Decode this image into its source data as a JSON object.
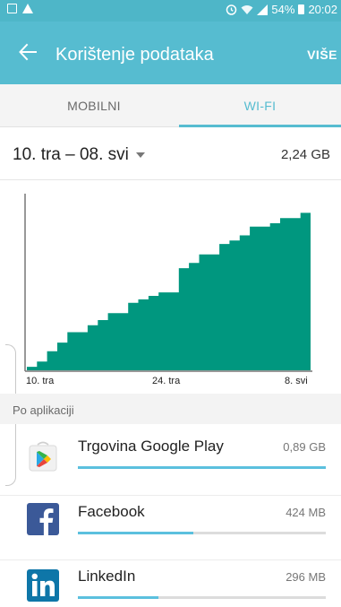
{
  "status_bar": {
    "battery": "54%",
    "time": "20:02"
  },
  "app_bar": {
    "title": "Korištenje podataka",
    "more_label": "VIŠE",
    "back_icon": "arrow-left-icon"
  },
  "tabs": [
    {
      "label": "MOBILNI",
      "selected": false
    },
    {
      "label": "WI-FI",
      "selected": true
    }
  ],
  "period": {
    "range": "10. tra – 08. svi",
    "total": "2,24 GB"
  },
  "colors": {
    "accent": "#56bcd0",
    "chart_fill": "#00977f",
    "usage_bar": "#5bc0de"
  },
  "chart_data": {
    "type": "area",
    "title": "",
    "xlabel": "",
    "ylabel": "",
    "x_tick_labels": [
      "10. tra",
      "24. tra",
      "8. svi"
    ],
    "x": [
      0,
      1,
      2,
      3,
      4,
      5,
      6,
      7,
      8,
      9,
      10,
      11,
      12,
      13,
      14,
      15,
      16,
      17,
      18,
      19,
      20,
      21,
      22,
      23,
      24,
      25,
      26,
      27,
      28
    ],
    "values": [
      0.02,
      0.05,
      0.11,
      0.16,
      0.22,
      0.22,
      0.26,
      0.29,
      0.33,
      0.33,
      0.39,
      0.41,
      0.43,
      0.45,
      0.45,
      0.59,
      0.62,
      0.67,
      0.67,
      0.73,
      0.75,
      0.78,
      0.83,
      0.83,
      0.85,
      0.88,
      0.88,
      0.91,
      0.91
    ],
    "ylim": [
      0,
      1
    ]
  },
  "section": {
    "label": "Po aplikaciji"
  },
  "apps": [
    {
      "name": "Trgovina Google Play",
      "usage": "0,89 GB",
      "fraction": 1.0,
      "icon": "google-play-icon"
    },
    {
      "name": "Facebook",
      "usage": "424 MB",
      "fraction": 0.465,
      "icon": "facebook-icon"
    },
    {
      "name": "LinkedIn",
      "usage": "296 MB",
      "fraction": 0.325,
      "icon": "linkedin-icon"
    }
  ]
}
